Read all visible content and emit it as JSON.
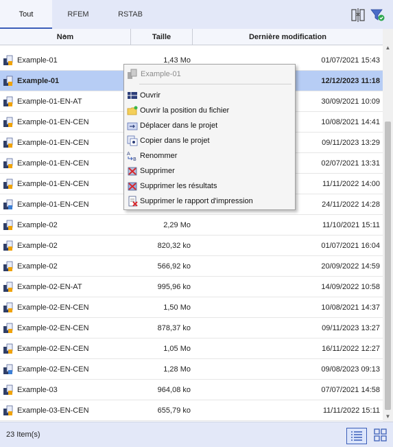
{
  "tabs": [
    {
      "label": "Tout",
      "active": true
    },
    {
      "label": "RFEM",
      "active": false
    },
    {
      "label": "RSTAB",
      "active": false
    }
  ],
  "header_icons": [
    "compare-columns-icon",
    "filter-icon"
  ],
  "columns": {
    "name": "Nom",
    "size": "Taille",
    "modified": "Dernière modification"
  },
  "rows": [
    {
      "name": "Example-01",
      "size": "1,43 Mo",
      "date": "01/07/2021 15:43",
      "icon": "rfem-file-icon",
      "selected": false
    },
    {
      "name": "Example-01",
      "size": "",
      "date": "12/12/2023 11:18",
      "icon": "rfem-file-icon",
      "selected": true
    },
    {
      "name": "Example-01-EN-AT",
      "size": "",
      "date": "30/09/2021 10:09",
      "icon": "rfem-file-icon",
      "selected": false
    },
    {
      "name": "Example-01-EN-CEN",
      "size": "",
      "date": "10/08/2021 14:41",
      "icon": "rfem-file-icon",
      "selected": false
    },
    {
      "name": "Example-01-EN-CEN",
      "size": "",
      "date": "09/11/2023 13:29",
      "icon": "rfem-file-icon",
      "selected": false
    },
    {
      "name": "Example-01-EN-CEN",
      "size": "",
      "date": "02/07/2021 13:31",
      "icon": "rfem-file-icon",
      "selected": false
    },
    {
      "name": "Example-01-EN-CEN",
      "size": "",
      "date": "11/11/2022 14:00",
      "icon": "rfem-file-icon",
      "selected": false
    },
    {
      "name": "Example-01-EN-CEN",
      "size": "",
      "date": "24/11/2022 14:28",
      "icon": "rstab-file-icon",
      "selected": false
    },
    {
      "name": "Example-02",
      "size": "2,29 Mo",
      "date": "11/10/2021 15:11",
      "icon": "rfem-file-icon",
      "selected": false
    },
    {
      "name": "Example-02",
      "size": "820,32 ko",
      "date": "01/07/2021 16:04",
      "icon": "rfem-file-icon",
      "selected": false
    },
    {
      "name": "Example-02",
      "size": "566,92 ko",
      "date": "20/09/2022 14:59",
      "icon": "rfem-file-icon",
      "selected": false
    },
    {
      "name": "Example-02-EN-AT",
      "size": "995,96 ko",
      "date": "14/09/2022 10:58",
      "icon": "rfem-file-icon",
      "selected": false
    },
    {
      "name": "Example-02-EN-CEN",
      "size": "1,50 Mo",
      "date": "10/08/2021 14:37",
      "icon": "rfem-file-icon",
      "selected": false
    },
    {
      "name": "Example-02-EN-CEN",
      "size": "878,37 ko",
      "date": "09/11/2023 13:27",
      "icon": "rfem-file-icon",
      "selected": false
    },
    {
      "name": "Example-02-EN-CEN",
      "size": "1,05 Mo",
      "date": "16/11/2022 12:27",
      "icon": "rfem-file-icon",
      "selected": false
    },
    {
      "name": "Example-02-EN-CEN",
      "size": "1,28 Mo",
      "date": "09/08/2023 09:13",
      "icon": "rstab-file-icon",
      "selected": false
    },
    {
      "name": "Example-03",
      "size": "964,08 ko",
      "date": "07/07/2021 14:58",
      "icon": "rfem-file-icon",
      "selected": false
    },
    {
      "name": "Example-03-EN-CEN",
      "size": "655,79 ko",
      "date": "11/11/2022 15:11",
      "icon": "rfem-file-icon",
      "selected": false
    }
  ],
  "context_menu": {
    "title": "Example-01",
    "items": [
      {
        "label": "Ouvrir",
        "icon": "open-model-icon"
      },
      {
        "label": "Ouvrir la position du fichier",
        "icon": "folder-icon"
      },
      {
        "label": "Déplacer dans le projet",
        "icon": "move-to-project-icon"
      },
      {
        "label": "Copier dans le projet",
        "icon": "copy-to-project-icon"
      },
      {
        "label": "Renommer",
        "icon": "rename-icon"
      },
      {
        "label": "Supprimer",
        "icon": "delete-icon"
      },
      {
        "label": "Supprimer les résultats",
        "icon": "delete-results-icon"
      },
      {
        "label": "Supprimer le rapport d'impression",
        "icon": "delete-report-icon"
      }
    ]
  },
  "status": {
    "count": "23 Item(s)"
  },
  "view_modes": [
    {
      "name": "list-view-icon",
      "active": true
    },
    {
      "name": "grid-view-icon",
      "active": false
    }
  ]
}
